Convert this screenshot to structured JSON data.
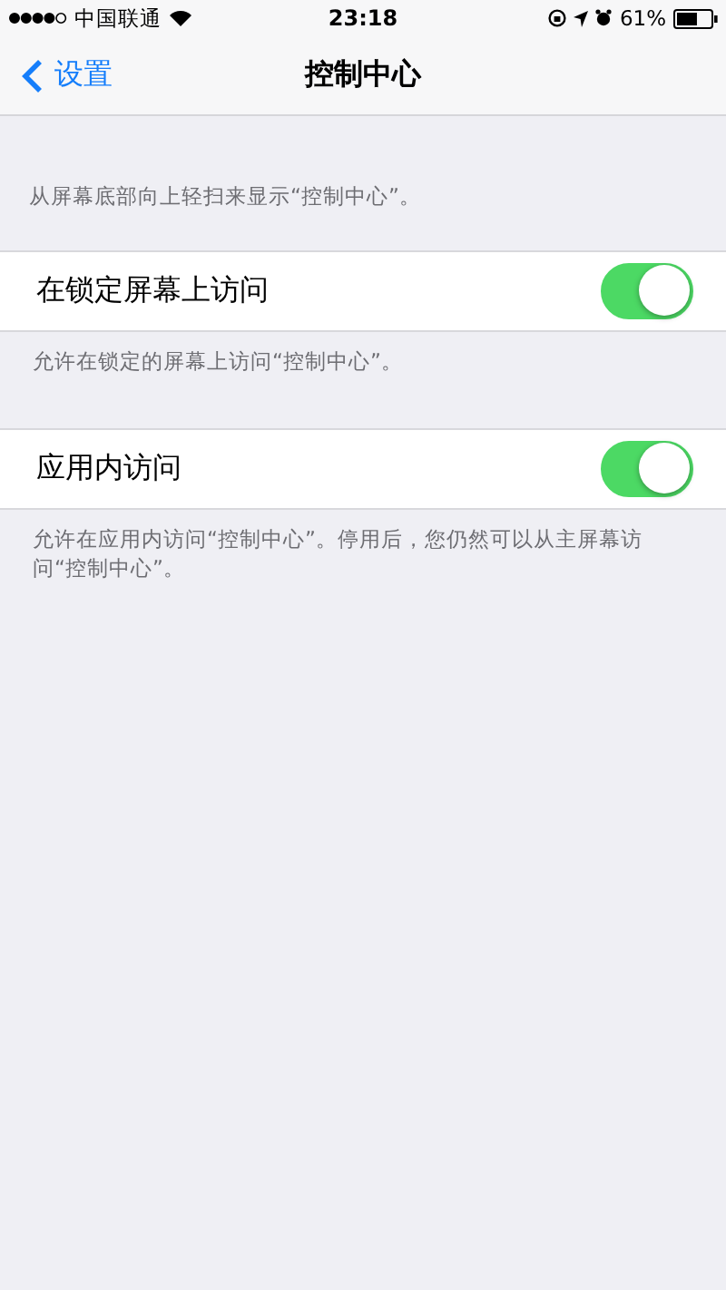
{
  "status_bar": {
    "carrier": "中国联通",
    "time": "23:18",
    "battery": "61%"
  },
  "nav": {
    "back": "设置",
    "title": "控制中心"
  },
  "intro": "从屏幕底部向上轻扫来显示“控制中心”。",
  "settings": [
    {
      "label": "在锁定屏幕上访问",
      "on": true,
      "footer": "允许在锁定的屏幕上访问“控制中心”。"
    },
    {
      "label": "应用内访问",
      "on": true,
      "footer": "允许在应用内访问“控制中心”。停用后，您仍然可以从主屏幕访问“控制中心”。"
    }
  ]
}
